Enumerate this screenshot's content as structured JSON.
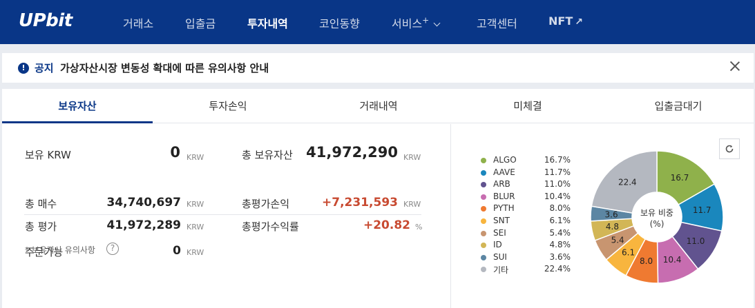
{
  "header": {
    "logo": "UPbit",
    "nav": [
      {
        "label": "거래소"
      },
      {
        "label": "입출금"
      },
      {
        "label": "투자내역"
      },
      {
        "label": "코인동향"
      },
      {
        "label": "서비스",
        "sup": "+"
      },
      {
        "label": "고객센터"
      },
      {
        "label": "NFT"
      }
    ]
  },
  "notice": {
    "label": "공지",
    "text": "가상자산시장 변동성 확대에 따른 유의사항 안내"
  },
  "tabs": [
    "보유자산",
    "투자손익",
    "거래내역",
    "미체결",
    "입출금대기"
  ],
  "summary": {
    "krw_label": "보유 KRW",
    "krw_value": "0",
    "total_assets_label": "총 보유자산",
    "total_assets_value": "41,972,290",
    "buy_label": "총 매수",
    "buy_value": "34,740,697",
    "eval_pl_label": "총평가손익",
    "eval_pl_value": "+7,231,593",
    "eval_label": "총 평가",
    "eval_value": "41,972,289",
    "eval_rate_label": "총평가수익률",
    "eval_rate_value": "+20.82",
    "orderable_label": "주문가능",
    "orderable_value": "0",
    "unit_krw": "KRW",
    "unit_pct": "%",
    "note": "* 보유자산 유의사항",
    "help": "?"
  },
  "colors": {
    "brand": "#093687",
    "positive": "#c84a31"
  },
  "chart_data": {
    "type": "pie",
    "center_label": "보유 비중",
    "center_sub": "(%)",
    "series": [
      {
        "name": "ALGO",
        "value": 16.7,
        "pct": "16.7%",
        "color": "#8fb14b"
      },
      {
        "name": "AAVE",
        "value": 11.7,
        "pct": "11.7%",
        "color": "#1a87bd"
      },
      {
        "name": "ARB",
        "value": 11.0,
        "pct": "11.0%",
        "color": "#61538f"
      },
      {
        "name": "BLUR",
        "value": 10.4,
        "pct": "10.4%",
        "color": "#c76db0"
      },
      {
        "name": "PYTH",
        "value": 8.0,
        "pct": "8.0%",
        "color": "#ef7a31"
      },
      {
        "name": "SNT",
        "value": 6.1,
        "pct": "6.1%",
        "color": "#f8b53e"
      },
      {
        "name": "SEI",
        "value": 5.4,
        "pct": "5.4%",
        "color": "#c89570"
      },
      {
        "name": "ID",
        "value": 4.8,
        "pct": "4.8%",
        "color": "#d2b656"
      },
      {
        "name": "SUI",
        "value": 3.6,
        "pct": "3.6%",
        "color": "#5c86a3"
      },
      {
        "name": "기타",
        "value": 22.4,
        "pct": "22.4%",
        "color": "#b4b8c0"
      }
    ]
  }
}
